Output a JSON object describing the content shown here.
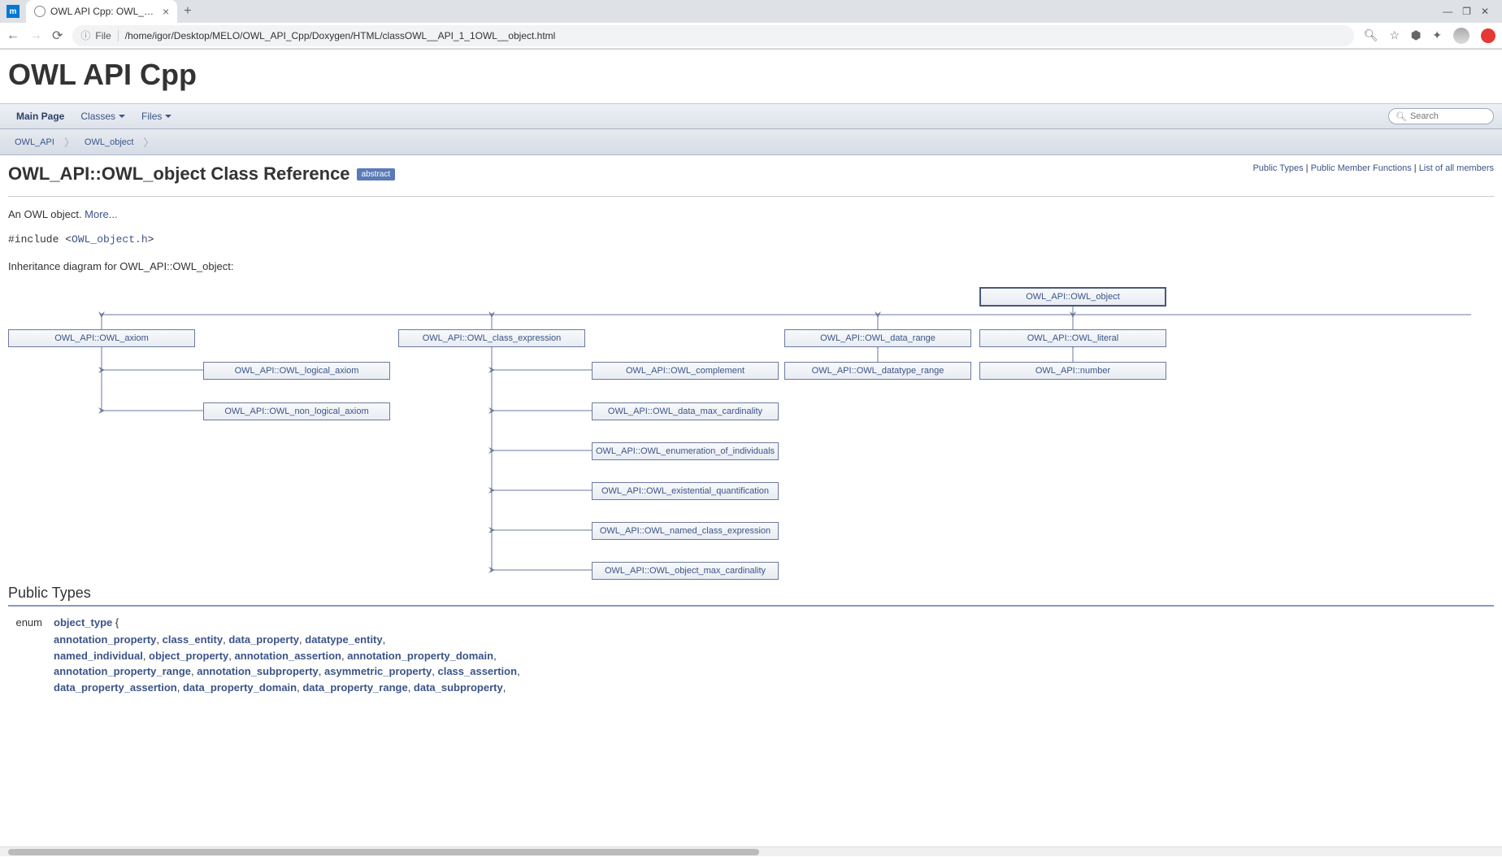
{
  "browser": {
    "tab_title": "OWL API Cpp: OWL_API::",
    "url_label": "File",
    "url": "/home/igor/Desktop/MELO/OWL_API_Cpp/Doxygen/HTML/classOWL__API_1_1OWL__object.html"
  },
  "search_placeholder": "Search",
  "project_title": "OWL API Cpp",
  "nav": {
    "main": "Main Page",
    "classes": "Classes",
    "files": "Files"
  },
  "breadcrumb": {
    "ns": "OWL_API",
    "cls": "OWL_object"
  },
  "quicklinks": {
    "a": "Public Types",
    "b": "Public Member Functions",
    "c": "List of all members"
  },
  "class_title": "OWL_API::OWL_object Class Reference",
  "badge_abstract": "abstract",
  "desc_text": "An OWL object. ",
  "more_link": "More...",
  "include_prefix": "#include <",
  "include_file": "OWL_object.h",
  "include_suffix": ">",
  "inherit_label": "Inheritance diagram for OWL_API::OWL_object:",
  "nodes": {
    "root": "OWL_API::OWL_object",
    "axiom": "OWL_API::OWL_axiom",
    "class_expr": "OWL_API::OWL_class_expression",
    "data_range": "OWL_API::OWL_data_range",
    "literal": "OWL_API::OWL_literal",
    "logical_axiom": "OWL_API::OWL_logical_axiom",
    "non_logical_axiom": "OWL_API::OWL_non_logical_axiom",
    "complement": "OWL_API::OWL_complement",
    "data_max_card": "OWL_API::OWL_data_max_cardinality",
    "enum_indiv": "OWL_API::OWL_enumeration_of_individuals",
    "exist_quant": "OWL_API::OWL_existential_quantification",
    "named_class": "OWL_API::OWL_named_class_expression",
    "obj_max_card": "OWL_API::OWL_object_max_cardinality",
    "datatype_range": "OWL_API::OWL_datatype_range",
    "number": "OWL_API::number"
  },
  "public_types_header": "Public Types",
  "enum_keyword": "enum",
  "enum_name": "object_type",
  "enum_values": [
    [
      "annotation_property",
      "class_entity",
      "data_property",
      "datatype_entity"
    ],
    [
      "named_individual",
      "object_property",
      "annotation_assertion",
      "annotation_property_domain"
    ],
    [
      "annotation_property_range",
      "annotation_subproperty",
      "asymmetric_property",
      "class_assertion"
    ],
    [
      "data_property_assertion",
      "data_property_domain",
      "data_property_range",
      "data_subproperty"
    ]
  ]
}
